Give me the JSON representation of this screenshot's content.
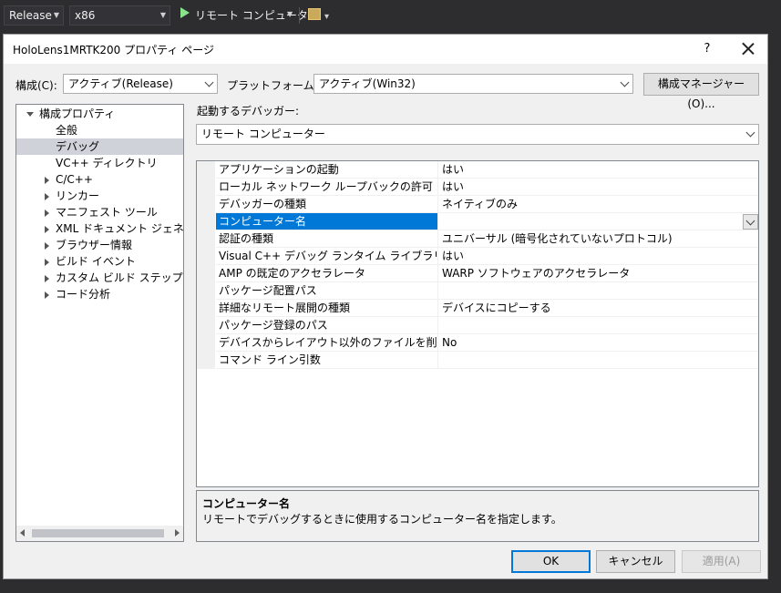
{
  "toolbar": {
    "config": "Release",
    "platform": "x86",
    "run_target": "リモート コンピューター"
  },
  "dialog": {
    "title": "HoloLens1MRTK200 プロパティ ページ",
    "help": "?",
    "config_label": "構成(C):",
    "config_value": "アクティブ(Release)",
    "platform_label": "プラットフォーム(P):",
    "platform_value": "アクティブ(Win32)",
    "config_manager": "構成マネージャー(O)...",
    "debugger_label": "起動するデバッガー:",
    "debugger_value": "リモート コンピューター",
    "ok": "OK",
    "cancel": "キャンセル",
    "apply": "適用(A)"
  },
  "tree": [
    {
      "label": "構成プロパティ",
      "expander": "open"
    },
    {
      "label": "全般",
      "expander": "none"
    },
    {
      "label": "デバッグ",
      "expander": "none",
      "selected": true
    },
    {
      "label": "VC++ ディレクトリ",
      "expander": "none"
    },
    {
      "label": "C/C++",
      "expander": "closed"
    },
    {
      "label": "リンカー",
      "expander": "closed"
    },
    {
      "label": "マニフェスト ツール",
      "expander": "closed"
    },
    {
      "label": "XML ドキュメント ジェネレーター",
      "expander": "closed"
    },
    {
      "label": "ブラウザー情報",
      "expander": "closed"
    },
    {
      "label": "ビルド イベント",
      "expander": "closed"
    },
    {
      "label": "カスタム ビルド ステップ",
      "expander": "closed"
    },
    {
      "label": "コード分析",
      "expander": "closed"
    }
  ],
  "properties": [
    {
      "name": "アプリケーションの起動",
      "value": "はい"
    },
    {
      "name": "ローカル ネットワーク ループバックの許可",
      "value": "はい"
    },
    {
      "name": "デバッガーの種類",
      "value": "ネイティブのみ"
    },
    {
      "name": "コンピューター名",
      "value": "",
      "selected": true
    },
    {
      "name": "認証の種類",
      "value": "ユニバーサル (暗号化されていないプロトコル)"
    },
    {
      "name": "Visual C++ デバッグ ランタイム ライブラリの配置",
      "value": "はい"
    },
    {
      "name": "AMP の既定のアクセラレータ",
      "value": "WARP ソフトウェアのアクセラレータ"
    },
    {
      "name": "パッケージ配置パス",
      "value": ""
    },
    {
      "name": "詳細なリモート展開の種類",
      "value": "デバイスにコピーする"
    },
    {
      "name": "パッケージ登録のパス",
      "value": ""
    },
    {
      "name": "デバイスからレイアウト以外のファイルを削除する",
      "value": "No"
    },
    {
      "name": "コマンド ライン引数",
      "value": ""
    }
  ],
  "description": {
    "title": "コンピューター名",
    "text": "リモートでデバッグするときに使用するコンピューター名を指定します。"
  },
  "colors": {
    "selection": "#0078d7",
    "toolbar_bg": "#2d2d30",
    "dialog_bg": "#f0f0f0"
  }
}
